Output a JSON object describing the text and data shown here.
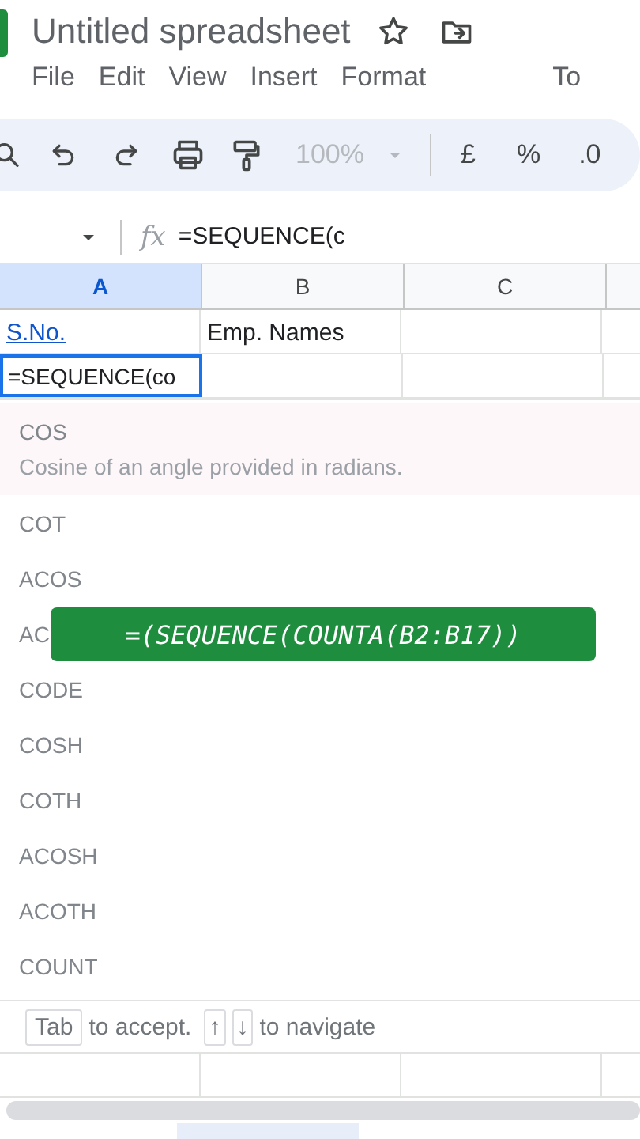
{
  "header": {
    "title": "Untitled spreadsheet"
  },
  "menu": [
    "File",
    "Edit",
    "View",
    "Insert",
    "Format",
    "To"
  ],
  "toolbar": {
    "zoom": "100%",
    "currency": "£",
    "percent": "%",
    "decimal": ".0"
  },
  "formula_bar": {
    "label": "fx",
    "value": "=SEQUENCE(c"
  },
  "columns": [
    {
      "label": "A",
      "selected": true
    },
    {
      "label": "B",
      "selected": false
    },
    {
      "label": "C",
      "selected": false
    }
  ],
  "rows": [
    {
      "cells": [
        {
          "text": "S.No.",
          "link": true
        },
        {
          "text": "Emp. Names",
          "link": false
        }
      ]
    }
  ],
  "editor": {
    "value": "=SEQUENCE(co"
  },
  "suggestions": [
    {
      "name": "COS",
      "description": "Cosine of an angle provided in radians.",
      "selected": true
    },
    {
      "name": "COT",
      "selected": false
    },
    {
      "name": "ACOS",
      "selected": false
    },
    {
      "name": "AC",
      "selected": false
    },
    {
      "name": "CODE",
      "selected": false
    },
    {
      "name": "COSH",
      "selected": false
    },
    {
      "name": "COTH",
      "selected": false
    },
    {
      "name": "ACOSH",
      "selected": false
    },
    {
      "name": "ACOTH",
      "selected": false
    },
    {
      "name": "COUNT",
      "selected": false
    }
  ],
  "hint": {
    "accept_key": "Tab",
    "accept_text": "to accept.",
    "nav_keys": [
      "↑",
      "↓"
    ],
    "nav_text": "to navigate"
  },
  "caption": "=(SEQUENCE(COUNTA(B2:B17))"
}
